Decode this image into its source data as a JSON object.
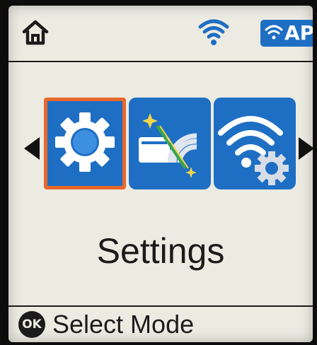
{
  "status_bar": {
    "home_icon": "home-icon",
    "wifi_icon": "wifi-signal-icon",
    "ap_badge_label": "AP"
  },
  "carousel": {
    "items": [
      {
        "icon": "gear-icon",
        "mode": "Settings",
        "selected": true
      },
      {
        "icon": "wifi-direct-setup-icon",
        "selected": false
      },
      {
        "icon": "wifi-settings-icon",
        "selected": false
      }
    ],
    "current_label": "Settings"
  },
  "footer": {
    "ok_button_label": "OK",
    "hint": "Select Mode"
  },
  "colors": {
    "screen_background": "#ecebe2",
    "tile_blue": "#1e6fc4",
    "selection_border": "#e8672a",
    "text": "#1b1b1b"
  }
}
